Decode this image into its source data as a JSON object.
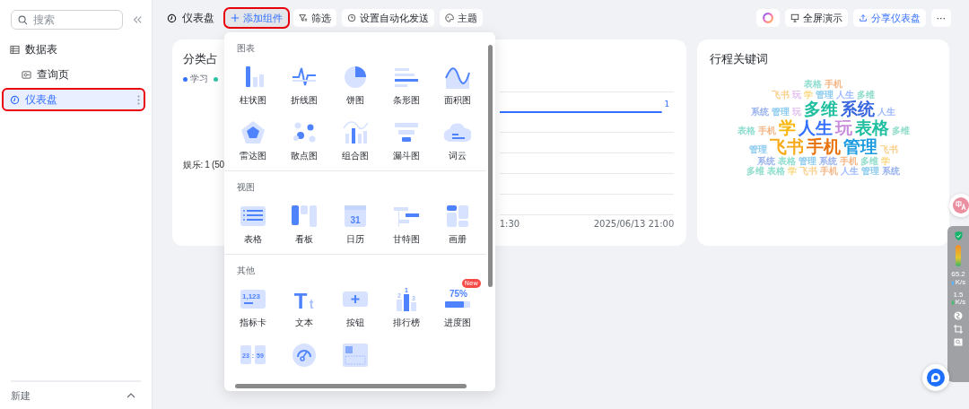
{
  "sidebar": {
    "search": {
      "placeholder": "搜索"
    },
    "items": [
      {
        "label": "数据表",
        "kind": "table",
        "selected": false,
        "highlighted": false,
        "children": [
          {
            "label": "查询页",
            "kind": "query",
            "selected": false,
            "highlighted": false
          }
        ]
      },
      {
        "label": "仪表盘",
        "kind": "dashboard",
        "selected": true,
        "highlighted": true
      }
    ],
    "footer": {
      "label": "新建"
    }
  },
  "toolbar": {
    "title": "仪表盘",
    "buttons": [
      {
        "label": "添加组件",
        "kind": "add",
        "highlighted": true
      },
      {
        "label": "筛选",
        "kind": "filter",
        "highlighted": false
      },
      {
        "label": "设置自动化发送",
        "kind": "automation",
        "highlighted": false
      },
      {
        "label": "主题",
        "kind": "theme",
        "highlighted": false
      }
    ],
    "right_buttons": [
      {
        "kind": "ai"
      },
      {
        "label": "全屏演示",
        "kind": "present"
      },
      {
        "label": "分享仪表盘",
        "kind": "share"
      },
      {
        "label": "···",
        "kind": "more"
      }
    ]
  },
  "cards": [
    {
      "kind": "pie",
      "title": "分类占",
      "legend": [
        {
          "label": "学习",
          "color": "#3370ff"
        },
        {
          "color": "#2ec4a5"
        }
      ],
      "labels": [
        "娱乐: 1 (50"
      ]
    },
    {
      "kind": "line",
      "value_label": "1",
      "x_labels": [
        "1:30",
        "2025/06/13 21:00"
      ]
    },
    {
      "kind": "wordcloud",
      "title": "行程关键词",
      "rows": [
        {
          "words": [
            {
              "text": "表格",
              "color": "#8edecf",
              "kind": "small"
            },
            {
              "text": "手机",
              "color": "#f3b584",
              "kind": "small"
            }
          ]
        },
        {
          "words": [
            {
              "text": "飞书",
              "color": "#fbd08a",
              "kind": "small"
            },
            {
              "text": "玩",
              "color": "#e2bfee",
              "kind": "small"
            },
            {
              "text": "学",
              "color": "#fbd980",
              "kind": "small"
            },
            {
              "text": "管理",
              "color": "#8ccbef",
              "kind": "small"
            },
            {
              "text": "人生",
              "color": "#99b6ff",
              "kind": "small"
            },
            {
              "text": "多维",
              "color": "#8fdcca",
              "kind": "small"
            }
          ]
        },
        {
          "words": [
            {
              "text": "系统",
              "color": "#9ab3ef",
              "kind": "small"
            },
            {
              "text": "管理",
              "color": "#8ccbef",
              "kind": "small"
            },
            {
              "text": "玩",
              "color": "#e2bfee",
              "kind": "small"
            },
            {
              "text": "多维",
              "color": "#1fbf9f",
              "kind": "large"
            },
            {
              "text": "系统",
              "color": "#3a66e0",
              "kind": "large"
            },
            {
              "text": "人生",
              "color": "#99b6ff",
              "kind": "small"
            }
          ]
        },
        {
          "words": [
            {
              "text": "表格",
              "color": "#8edecf",
              "kind": "small"
            },
            {
              "text": "手机",
              "color": "#f3b584",
              "kind": "small"
            },
            {
              "text": "学",
              "color": "#f9b70c",
              "kind": "large"
            },
            {
              "text": "人生",
              "color": "#3370ff",
              "kind": "large"
            },
            {
              "text": "玩",
              "color": "#c98bdc",
              "kind": "large"
            },
            {
              "text": "表格",
              "color": "#1fbfa0",
              "kind": "large"
            },
            {
              "text": "多维",
              "color": "#8fdcca",
              "kind": "small"
            }
          ]
        },
        {
          "words": [
            {
              "text": "管理",
              "color": "#8ccbef",
              "kind": "small"
            },
            {
              "text": "飞书",
              "color": "#f8ab1a",
              "kind": "large"
            },
            {
              "text": "手机",
              "color": "#e8720c",
              "kind": "large"
            },
            {
              "text": "管理",
              "color": "#1a9be0",
              "kind": "large"
            },
            {
              "text": "飞书",
              "color": "#fbd08a",
              "kind": "small"
            }
          ]
        },
        {
          "words": [
            {
              "text": "系统",
              "color": "#9ab3ef",
              "kind": "small"
            },
            {
              "text": "表格",
              "color": "#8edecf",
              "kind": "small"
            },
            {
              "text": "管理",
              "color": "#8ccbef",
              "kind": "small"
            },
            {
              "text": "系统",
              "color": "#9ab3ef",
              "kind": "small"
            },
            {
              "text": "手机",
              "color": "#f3b584",
              "kind": "small"
            },
            {
              "text": "多维",
              "color": "#8fdcca",
              "kind": "small"
            },
            {
              "text": "学",
              "color": "#fbd980",
              "kind": "small"
            }
          ]
        },
        {
          "words": [
            {
              "text": "多维",
              "color": "#8fdcca",
              "kind": "small"
            },
            {
              "text": "表格",
              "color": "#8edecf",
              "kind": "small"
            },
            {
              "text": "学",
              "color": "#fbd980",
              "kind": "small"
            },
            {
              "text": "飞书",
              "color": "#fbd08a",
              "kind": "small"
            },
            {
              "text": "手机",
              "color": "#f3b584",
              "kind": "small"
            },
            {
              "text": "人生",
              "color": "#99b6ff",
              "kind": "small"
            },
            {
              "text": "管理",
              "color": "#8ccbef",
              "kind": "small"
            },
            {
              "text": "系统",
              "color": "#9ab3ef",
              "kind": "small"
            }
          ]
        }
      ]
    }
  ],
  "component_menu": {
    "sections": [
      {
        "title": "图表",
        "items": [
          {
            "label": "柱状图",
            "kind": "bar"
          },
          {
            "label": "折线图",
            "kind": "line"
          },
          {
            "label": "饼图",
            "kind": "pie"
          },
          {
            "label": "条形图",
            "kind": "hbar"
          },
          {
            "label": "面积图",
            "kind": "area"
          },
          {
            "label": "雷达图",
            "kind": "radar"
          },
          {
            "label": "散点图",
            "kind": "scatter"
          },
          {
            "label": "组合图",
            "kind": "combo"
          },
          {
            "label": "漏斗图",
            "kind": "funnel"
          },
          {
            "label": "词云",
            "kind": "cloud"
          }
        ]
      },
      {
        "title": "视图",
        "items": [
          {
            "label": "表格",
            "kind": "table"
          },
          {
            "label": "看板",
            "kind": "kanban"
          },
          {
            "label": "日历",
            "kind": "calendar",
            "icon_texts": [
              "31"
            ]
          },
          {
            "label": "甘特图",
            "kind": "gantt"
          },
          {
            "label": "画册",
            "kind": "gallery"
          }
        ]
      },
      {
        "title": "其他",
        "items": [
          {
            "label": "指标卡",
            "kind": "metric",
            "icon_texts": [
              "1,123"
            ]
          },
          {
            "label": "文本",
            "kind": "text",
            "icon_texts": [
              "T",
              "t"
            ]
          },
          {
            "label": "按钮",
            "kind": "button"
          },
          {
            "label": "排行榜",
            "kind": "rank",
            "icon_texts": [
              "1",
              "2",
              "3"
            ]
          },
          {
            "label": "进度图",
            "kind": "progress",
            "icon_texts": [
              "75%"
            ],
            "badge": "New"
          },
          {
            "kind": "countdown",
            "icon_texts": [
              "23",
              ":",
              "59"
            ]
          },
          {
            "kind": "nps"
          },
          {
            "kind": "layout"
          }
        ]
      }
    ]
  },
  "side_tools": {
    "readings": [
      {
        "value": "65.2",
        "unit": "K/s",
        "kind": "up"
      },
      {
        "value": "1.5",
        "unit": "K/s",
        "kind": "down"
      }
    ]
  }
}
